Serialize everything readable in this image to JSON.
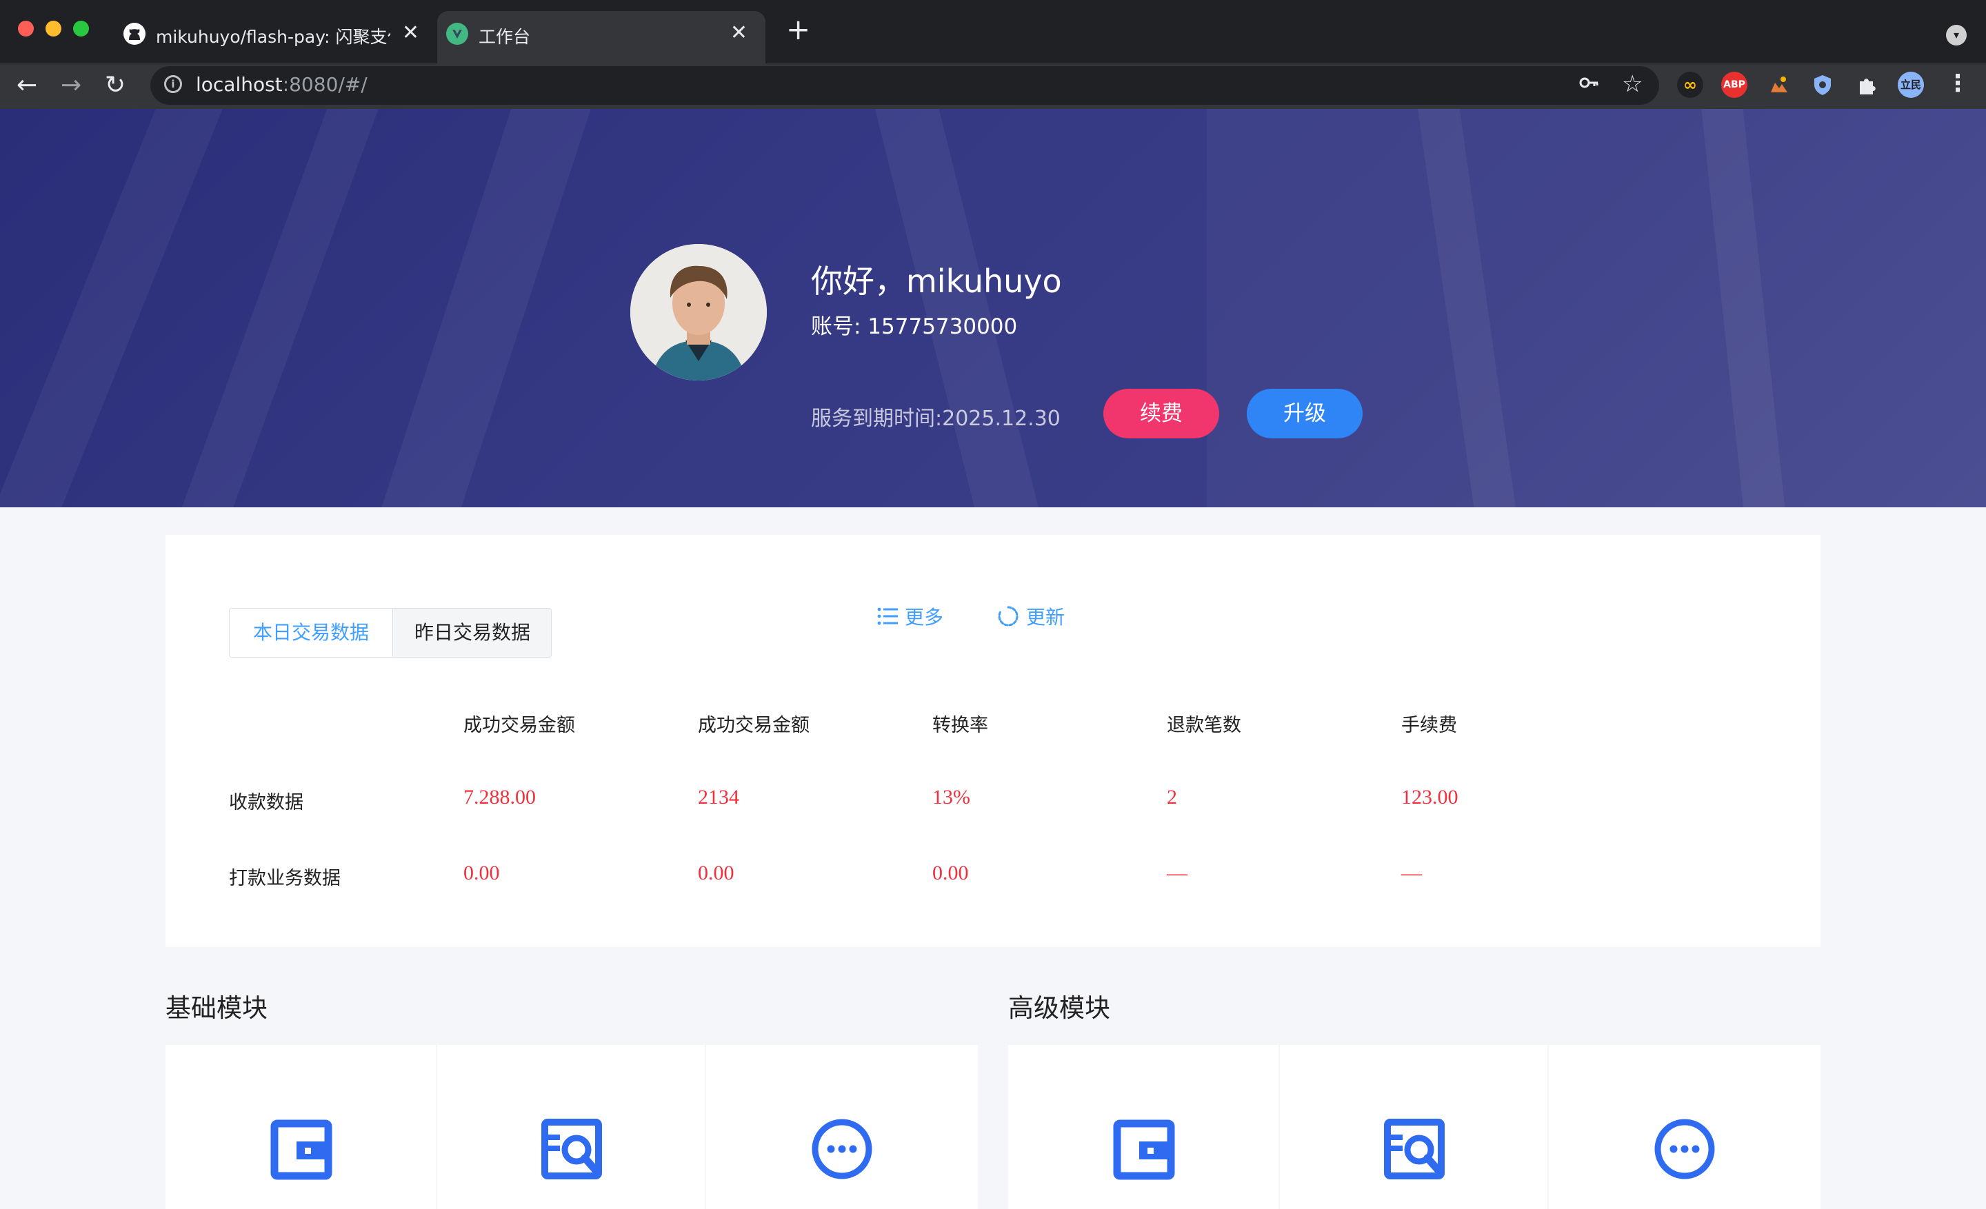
{
  "browser": {
    "tabs": [
      {
        "title": "mikuhuyo/flash-pay: 闪聚支付是",
        "icon": "github-icon"
      },
      {
        "title": "工作台",
        "icon": "vue-icon"
      }
    ],
    "url_host": "localhost",
    "url_rest": ":8080/#/",
    "profile_label": "立民",
    "extensions": [
      "infinity-extension-icon",
      "abp-extension-icon",
      "cloud-extension-icon",
      "shield-extension-icon",
      "puzzle-extensions-icon"
    ],
    "abp_label": "ABP"
  },
  "hero": {
    "greeting": "你好，mikuhuyo",
    "account": "账号: 15775730000",
    "expiry": "服务到期时间:2025.12.30",
    "renew_label": "续费",
    "upgrade_label": "升级"
  },
  "stats": {
    "tabs": [
      "本日交易数据",
      "昨日交易数据"
    ],
    "active_tab": "本日交易数据",
    "more_label": "更多",
    "refresh_label": "更新",
    "columns": [
      "成功交易金额",
      "成功交易金额",
      "转换率",
      "退款笔数",
      "手续费"
    ],
    "rows": [
      {
        "label": "收款数据",
        "values": [
          "7.288.00",
          "2134",
          "13%",
          "2",
          "123.00"
        ]
      },
      {
        "label": "打款业务数据",
        "values": [
          "0.00",
          "0.00",
          "0.00",
          "—",
          "—"
        ]
      }
    ]
  },
  "modules": {
    "basic_title": "基础模块",
    "advanced_title": "高级模块",
    "icons": [
      "wallet-icon",
      "search-document-icon",
      "more-dots-icon"
    ]
  },
  "colors": {
    "accent_blue": "#409eff",
    "renew_pink": "#f1356d",
    "upgrade_blue": "#2f85f5",
    "value_red": "#f0303c",
    "hero_navy": "#353984"
  }
}
